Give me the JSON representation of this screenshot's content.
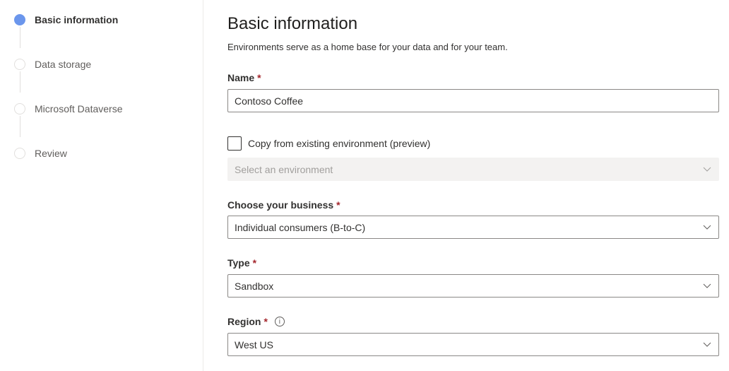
{
  "steps": [
    {
      "label": "Basic information",
      "active": true
    },
    {
      "label": "Data storage",
      "active": false
    },
    {
      "label": "Microsoft Dataverse",
      "active": false
    },
    {
      "label": "Review",
      "active": false
    }
  ],
  "colors": {
    "accent": "#6b96ec",
    "required": "#a4262c"
  },
  "form": {
    "title": "Basic information",
    "subtitle": "Environments serve as a home base for your data and for your team.",
    "name_label": "Name",
    "name_value": "Contoso Coffee",
    "required_mark": "*",
    "copy_label": "Copy from existing environment (preview)",
    "copy_checked": false,
    "environment_placeholder": "Select an environment",
    "business_label": "Choose your business",
    "business_value": "Individual consumers (B-to-C)",
    "type_label": "Type",
    "type_value": "Sandbox",
    "region_label": "Region",
    "region_value": "West US",
    "info_icon": "i"
  }
}
